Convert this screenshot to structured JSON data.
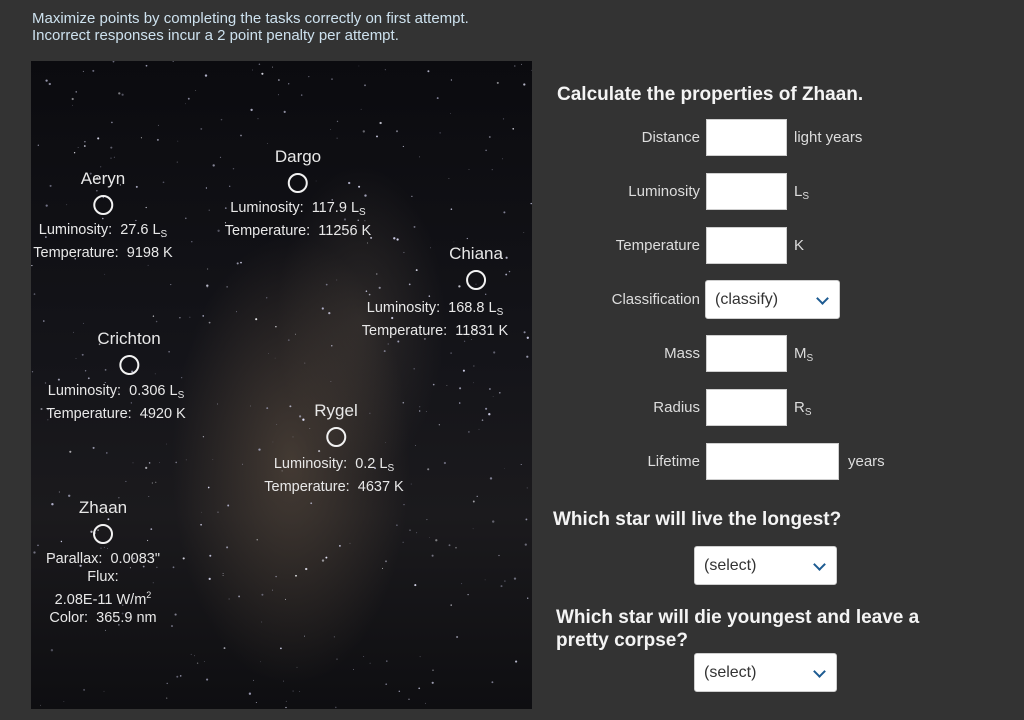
{
  "instructions": {
    "line1": "Maximize points by completing the tasks correctly on first attempt.",
    "line2": "Incorrect responses incur a 2 point penalty per attempt."
  },
  "stars": [
    {
      "id": "aeryn",
      "name": "Aeryn",
      "luminosity_label": "Luminosity:",
      "luminosity": "27.6",
      "lum_unit": "L",
      "lum_sub": "S",
      "temperature_label": "Temperature:",
      "temperature": "9198 K"
    },
    {
      "id": "dargo",
      "name": "Dargo",
      "luminosity_label": "Luminosity:",
      "luminosity": "117.9",
      "lum_unit": "L",
      "lum_sub": "S",
      "temperature_label": "Temperature:",
      "temperature": "11256 K"
    },
    {
      "id": "chiana",
      "name": "Chiana",
      "luminosity_label": "Luminosity:",
      "luminosity": "168.8",
      "lum_unit": "L",
      "lum_sub": "S",
      "temperature_label": "Temperature:",
      "temperature": "11831 K"
    },
    {
      "id": "crichton",
      "name": "Crichton",
      "luminosity_label": "Luminosity:",
      "luminosity": "0.306",
      "lum_unit": "L",
      "lum_sub": "S",
      "temperature_label": "Temperature:",
      "temperature": "4920 K"
    },
    {
      "id": "rygel",
      "name": "Rygel",
      "luminosity_label": "Luminosity:",
      "luminosity": "0.2",
      "lum_unit": "L",
      "lum_sub": "S",
      "temperature_label": "Temperature:",
      "temperature": "4637 K"
    }
  ],
  "zhaan": {
    "name": "Zhaan",
    "parallax_label": "Parallax:",
    "parallax": "0.0083\"",
    "flux_label": "Flux:",
    "flux_value": "2.08E-11 W/m",
    "flux_sup": "2",
    "color_label": "Color:",
    "color": "365.9 nm"
  },
  "panel": {
    "title": "Calculate the properties of Zhaan.",
    "fields": {
      "distance": {
        "label": "Distance",
        "value": "",
        "unit": "light years"
      },
      "luminosity": {
        "label": "Luminosity",
        "value": "",
        "unit": "L",
        "unit_sub": "S"
      },
      "temperature": {
        "label": "Temperature",
        "value": "",
        "unit": "K"
      },
      "classification": {
        "label": "Classification",
        "selected": "(classify)"
      },
      "mass": {
        "label": "Mass",
        "value": "",
        "unit": "M",
        "unit_sub": "S"
      },
      "radius": {
        "label": "Radius",
        "value": "",
        "unit": "R",
        "unit_sub": "S"
      },
      "lifetime": {
        "label": "Lifetime",
        "value": "",
        "unit": "years"
      }
    },
    "q1": {
      "question": "Which star will live the longest?",
      "selected": "(select)"
    },
    "q2": {
      "question_line1": "Which star will die youngest and leave a",
      "question_line2": "pretty corpse?",
      "selected": "(select)"
    }
  },
  "icons": {
    "dropdown": "chevron-down-icon",
    "star_marker": "circle-icon"
  },
  "colors": {
    "background": "#333333",
    "instructions": "#cde1ee",
    "chevron": "#1d5b92"
  }
}
